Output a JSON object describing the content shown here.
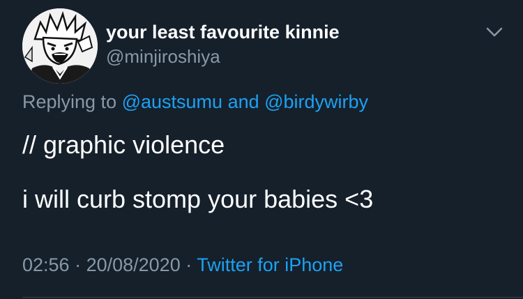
{
  "tweet": {
    "display_name": "your least favourite kinnie",
    "handle": "@minjiroshiya",
    "replying_prefix": "Replying to ",
    "reply_to_1": "@austsumu",
    "reply_joiner": " and ",
    "reply_to_2": "@birdywirby",
    "text_line_1": "// graphic violence",
    "text_line_2": "i will curb stomp your babies <3",
    "time": "02:56",
    "separator_1": " · ",
    "date": "20/08/2020",
    "separator_2": " · ",
    "source": "Twitter for iPhone"
  },
  "icons": {
    "avatar": "avatar-manga-character",
    "more_options": "chevron-down-icon"
  },
  "colors": {
    "background": "#15202b",
    "primary_text": "#ffffff",
    "secondary_text": "#8899a6",
    "link": "#1da1f2",
    "divider": "#38444d"
  }
}
